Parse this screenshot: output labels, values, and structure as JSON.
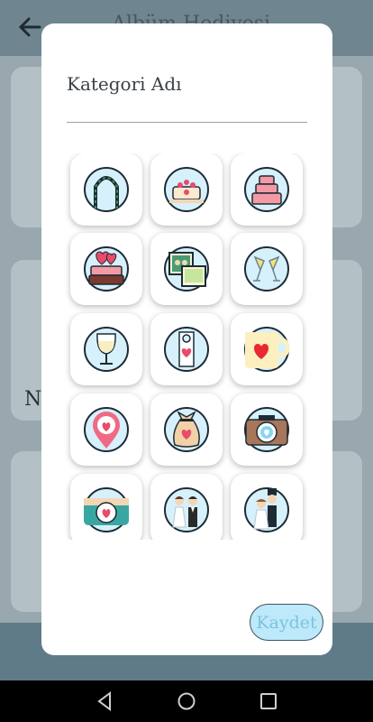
{
  "app": {
    "title": "Albüm Hediyesi",
    "card_text": "N"
  },
  "dialog": {
    "category_name_placeholder": "Kategori Adı",
    "save_label": "Kaydet"
  },
  "icons": [
    "wedding-arch-icon",
    "wedding-cake-roses-icon",
    "wedding-cake-icon",
    "heart-cake-icon",
    "photo-frames-icon",
    "champagne-glasses-icon",
    "wine-glass-icon",
    "door-hanger-icon",
    "heart-mug-icon",
    "location-heart-icon",
    "gift-bag-icon",
    "camera-heart-icon",
    "teal-camera-icon",
    "bride-groom-icon",
    "wedding-couple-icon"
  ],
  "colors": {
    "accent": "#bde9fb",
    "icon_circle": "#d6f1fb",
    "heart": "#e94b6b"
  }
}
